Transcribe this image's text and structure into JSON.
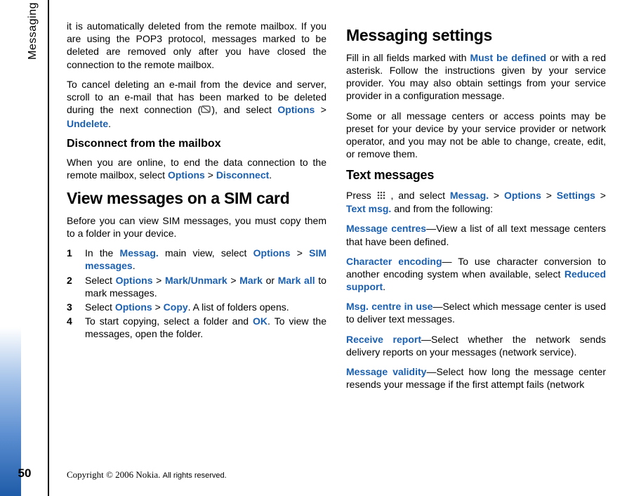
{
  "sidebar": {
    "tab_label": "Messaging",
    "page_number": "50"
  },
  "left": {
    "p1": "it is automatically deleted from the remote mailbox. If you are using the POP3 protocol, messages marked to be deleted are removed only after you have closed the connection to the remote mailbox.",
    "p2a": "To cancel deleting an e-mail from the device and server, scroll to an e-mail that has been marked to be deleted during the next connection (",
    "p2b": "), and select ",
    "p2_opt": "Options",
    "gt": " > ",
    "p2_undel": "Undelete",
    "p2_end": ".",
    "h3_disconnect": "Disconnect from the mailbox",
    "p3a": "When you are online, to end the data connection to the remote mailbox, select ",
    "p3_opt": "Options",
    "p3_disc": "Disconnect",
    "p3_end": ".",
    "h1_sim": "View messages on a SIM card",
    "p4": "Before you can view SIM messages, you must copy them to a folder in your device.",
    "steps": {
      "s1a": "In the ",
      "s1_messag": "Messag.",
      "s1b": " main view, select ",
      "s1_opt": "Options",
      "s1_sim": "SIM messages",
      "s1_end": ".",
      "s2a": "Select ",
      "s2_opt": "Options",
      "s2_mm": "Mark/Unmark",
      "s2_mark": "Mark",
      "s2_or": " or ",
      "s2_markall": "Mark all",
      "s2_end": " to mark messages.",
      "s3a": "Select ",
      "s3_opt": "Options",
      "s3_copy": "Copy",
      "s3_end": ". A list of folders opens.",
      "s4a": "To start copying, select a folder and ",
      "s4_ok": "OK",
      "s4_end": ". To view the messages, open the folder."
    }
  },
  "right": {
    "h1_settings": "Messaging settings",
    "p1a": "Fill in all fields marked with ",
    "p1_mbd": "Must be defined",
    "p1b": " or with a red asterisk. Follow the instructions given by your service provider. You may also obtain settings from your service provider in a configuration message.",
    "p2": "Some or all message centers or access points may be preset for your device by your service provider or network operator, and you may not be able to change, create, edit, or remove them.",
    "h2_text": "Text messages",
    "p3a": "Press ",
    "p3b": " , and select ",
    "p3_messag": "Messag.",
    "gt": " > ",
    "p3_opt": "Options",
    "p3_set": "Settings",
    "p3_txt": "Text msg.",
    "p3_end": " and from the following:",
    "mc_label": "Message centres",
    "mc_text": "—View a list of all text message centers that have been defined.",
    "ce_label": "Character encoding",
    "ce_text1": "— To use character conversion to another encoding system when available, select ",
    "ce_red": "Reduced support",
    "ce_text2": ".",
    "mciu_label": "Msg. centre in use",
    "mciu_text": "—Select which message center is used to deliver text messages.",
    "rr_label": "Receive report",
    "rr_text": "—Select whether the network sends delivery reports on your messages (network service).",
    "mv_label": "Message validity",
    "mv_text": "—Select how long the message center resends your message if the first attempt fails (network"
  },
  "copyright": {
    "main": "Copyright © 2006 Nokia. ",
    "tail": "All rights reserved."
  }
}
